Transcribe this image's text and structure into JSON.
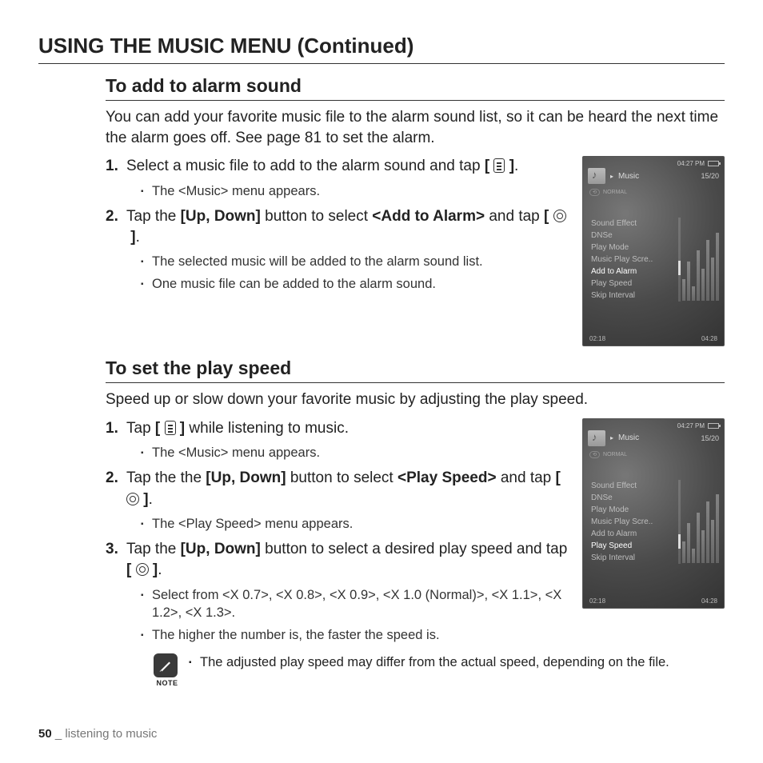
{
  "pageTitle": "USING THE MUSIC MENU (Continued)",
  "section1": {
    "heading": "To add to alarm sound",
    "intro": "You can add your favorite music file to the alarm sound list, so it can be heard the next time the alarm goes off. See page 81 to set the alarm.",
    "steps": {
      "s1_a": "Select a music file to add to the alarm sound and tap ",
      "s1_b": ".",
      "s1_sub1": "The <Music> menu appears.",
      "s2_a": "Tap the ",
      "s2_bold1": "[Up, Down]",
      "s2_b": " button to select ",
      "s2_bold2": "<Add to Alarm>",
      "s2_c": " and tap ",
      "s2_d": ".",
      "s2_sub1": "The selected music will be added to the alarm sound list.",
      "s2_sub2": "One music file can be added to the alarm sound."
    }
  },
  "section2": {
    "heading": "To set the play speed",
    "intro": "Speed up or slow down your favorite music by adjusting the play speed.",
    "steps": {
      "s1_a": "Tap ",
      "s1_b": " while listening to music.",
      "s1_sub1": "The <Music> menu appears.",
      "s2_a": "Tap the the ",
      "s2_bold1": "[Up, Down]",
      "s2_b": " button to select ",
      "s2_bold2": "<Play Speed>",
      "s2_c": " and tap ",
      "s2_d": ".",
      "s2_sub1": "The <Play Speed> menu appears.",
      "s3_a": "Tap the ",
      "s3_bold1": "[Up, Down]",
      "s3_b": " button to select a desired play speed and tap ",
      "s3_c": ".",
      "s3_sub1": "Select from <X 0.7>, <X 0.8>, <X 0.9>, <X 1.0 (Normal)>, <X 1.1>, <X 1.2>, <X 1.3>.",
      "s3_sub2": "The higher the number is, the faster the speed is."
    },
    "noteLabel": "NOTE",
    "noteText": "The adjusted play speed may differ from the actual speed, depending on the file."
  },
  "device": {
    "time": "04:27 PM",
    "title": "Music",
    "counter": "15/20",
    "mode": "NORMAL",
    "timeLeft": "02:18",
    "timeRight": "04:28",
    "menu": [
      "Sound Effect",
      "DNSe",
      "Play Mode",
      "Music Play Scre..",
      "Add to Alarm",
      "Play Speed",
      "Skip Interval"
    ],
    "selected1": "Add to Alarm",
    "selected2": "Play Speed"
  },
  "footer": {
    "pageNum": "50",
    "sep": " _ ",
    "chapter": "listening to music"
  }
}
